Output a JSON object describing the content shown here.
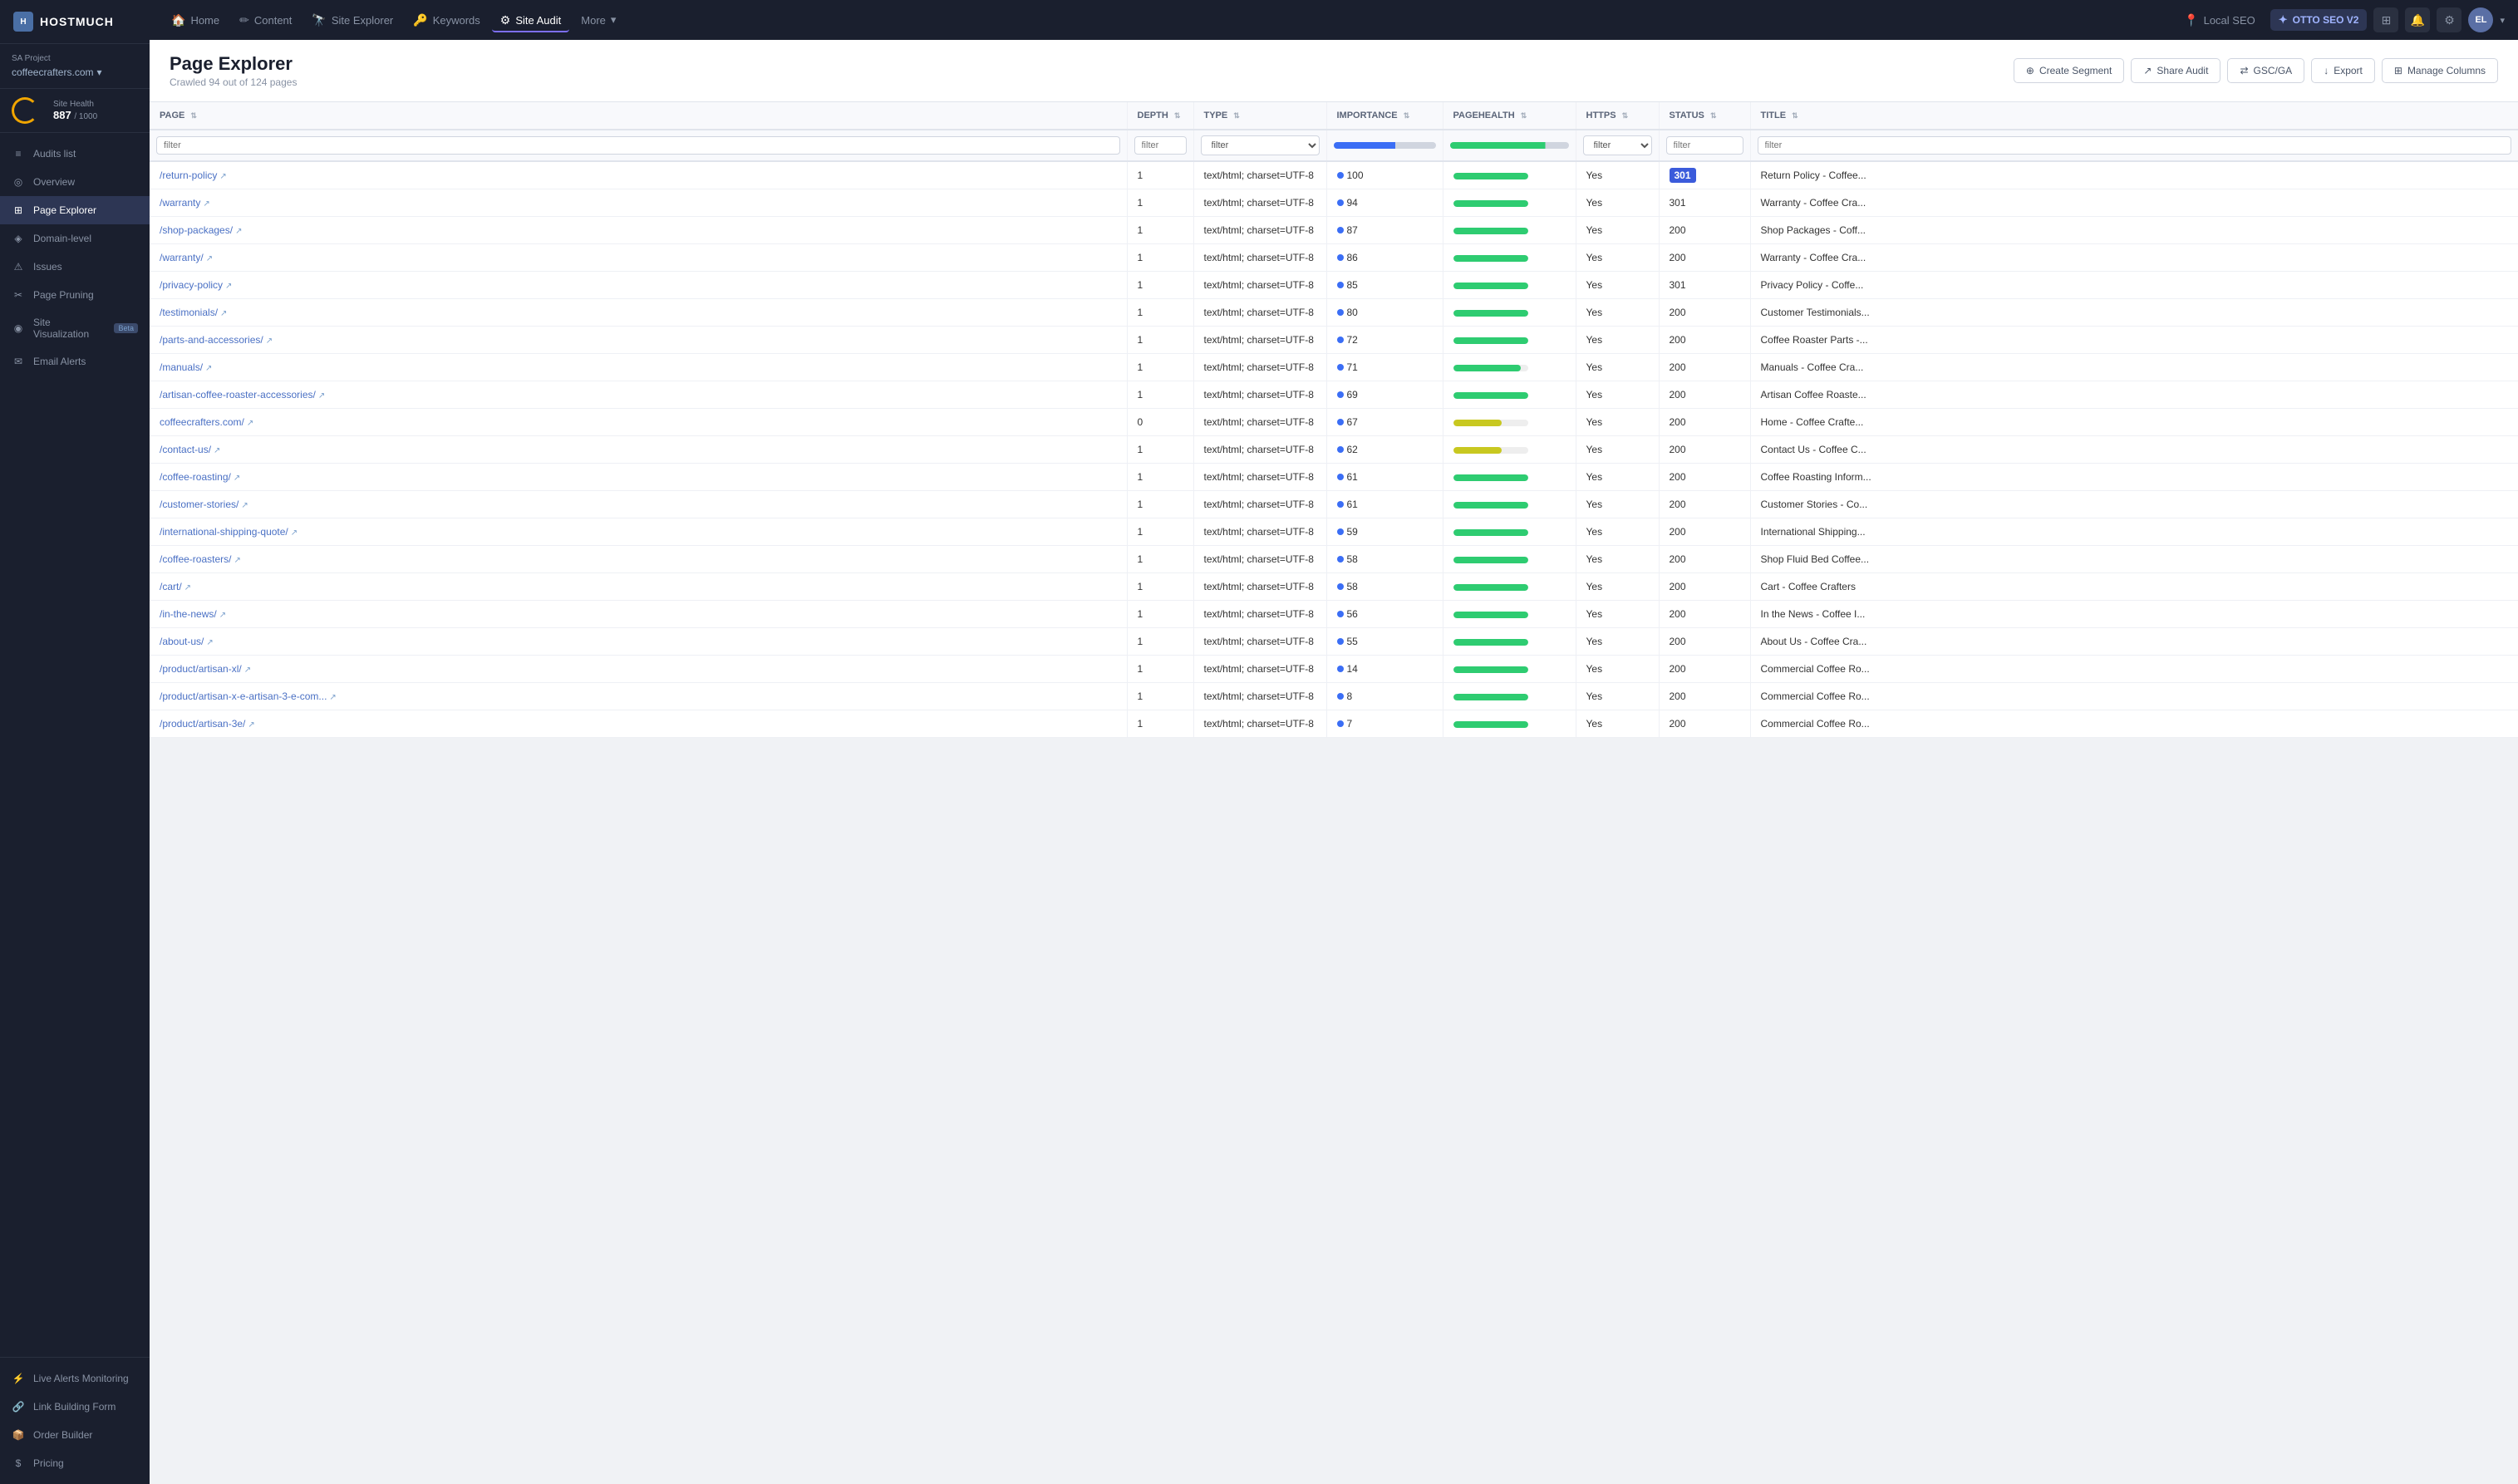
{
  "sidebar": {
    "logo_text": "HOSTMUCH",
    "project_label": "SA Project",
    "project_name": "coffeecrafters.com",
    "health_label": "Site Health",
    "health_value": "887",
    "health_max": "/ 1000",
    "nav_items": [
      {
        "id": "audits",
        "label": "Audits list",
        "icon": "≡"
      },
      {
        "id": "overview",
        "label": "Overview",
        "icon": "◎"
      },
      {
        "id": "explorer",
        "label": "Page Explorer",
        "icon": "⊞",
        "active": true
      },
      {
        "id": "domain",
        "label": "Domain-level",
        "icon": "◈"
      },
      {
        "id": "issues",
        "label": "Issues",
        "icon": "⚠"
      },
      {
        "id": "pruning",
        "label": "Page Pruning",
        "icon": "✂"
      },
      {
        "id": "visualization",
        "label": "Site Visualization",
        "icon": "◉",
        "beta": true
      },
      {
        "id": "alerts",
        "label": "Email Alerts",
        "icon": "✉"
      }
    ],
    "bottom_items": [
      {
        "id": "live-alerts",
        "label": "Live Alerts Monitoring",
        "icon": "⚡"
      },
      {
        "id": "link-building",
        "label": "Link Building Form",
        "icon": "🔗"
      },
      {
        "id": "order-builder",
        "label": "Order Builder",
        "icon": "📦"
      },
      {
        "id": "pricing",
        "label": "Pricing",
        "icon": "$"
      }
    ]
  },
  "topnav": {
    "items": [
      {
        "id": "home",
        "label": "Home",
        "icon": "🏠"
      },
      {
        "id": "content",
        "label": "Content",
        "icon": "✏"
      },
      {
        "id": "site-explorer",
        "label": "Site Explorer",
        "icon": "🔭"
      },
      {
        "id": "keywords",
        "label": "Keywords",
        "icon": "🔑"
      },
      {
        "id": "site-audit",
        "label": "Site Audit",
        "icon": "⚙",
        "active": true
      },
      {
        "id": "more",
        "label": "More",
        "icon": "▾"
      },
      {
        "id": "local-seo",
        "label": "Local SEO",
        "icon": "📍"
      }
    ],
    "otto_label": "OTTO SEO V2",
    "avatar_initials": "EL"
  },
  "page": {
    "title": "Page Explorer",
    "subtitle": "Crawled 94 out of 124 pages",
    "actions": [
      {
        "id": "create-segment",
        "label": "Create Segment",
        "icon": "⊕"
      },
      {
        "id": "share-audit",
        "label": "Share Audit",
        "icon": "↗"
      },
      {
        "id": "gsc-ga",
        "label": "GSC/GA",
        "icon": "⇄"
      },
      {
        "id": "export",
        "label": "Export",
        "icon": "↓"
      },
      {
        "id": "manage-columns",
        "label": "Manage Columns",
        "icon": "⊞"
      }
    ]
  },
  "table": {
    "columns": [
      {
        "id": "page",
        "label": "PAGE",
        "sortable": true
      },
      {
        "id": "depth",
        "label": "DEPTH",
        "sortable": true
      },
      {
        "id": "type",
        "label": "TYPE",
        "sortable": true
      },
      {
        "id": "importance",
        "label": "IMPORTANCE",
        "sortable": true
      },
      {
        "id": "pagehealth",
        "label": "PAGEHEALTH",
        "sortable": true
      },
      {
        "id": "https",
        "label": "HTTPS",
        "sortable": true
      },
      {
        "id": "status",
        "label": "STATUS",
        "sortable": true
      },
      {
        "id": "title",
        "label": "TITLE",
        "sortable": true
      }
    ],
    "rows": [
      {
        "page": "/return-policy",
        "depth": 1,
        "type": "text/html; charset=UTF-8",
        "importance": 100,
        "importance_color": "#3b6ef5",
        "health": 100,
        "health_color": "#2ecc71",
        "https": "Yes",
        "status": 301,
        "status_highlight": true,
        "title": "Return Policy - Coffee..."
      },
      {
        "page": "/warranty",
        "depth": 1,
        "type": "text/html; charset=UTF-8",
        "importance": 94,
        "importance_color": "#3b6ef5",
        "health": 100,
        "health_color": "#2ecc71",
        "https": "Yes",
        "status": 301,
        "status_highlight": false,
        "title": "Warranty - Coffee Cra..."
      },
      {
        "page": "/shop-packages/",
        "depth": 1,
        "type": "text/html; charset=UTF-8",
        "importance": 87,
        "importance_color": "#3b6ef5",
        "health": 100,
        "health_color": "#2ecc71",
        "https": "Yes",
        "status": 200,
        "status_highlight": false,
        "title": "Shop Packages - Coff..."
      },
      {
        "page": "/warranty/",
        "depth": 1,
        "type": "text/html; charset=UTF-8",
        "importance": 86,
        "importance_color": "#3b6ef5",
        "health": 100,
        "health_color": "#2ecc71",
        "https": "Yes",
        "status": 200,
        "status_highlight": false,
        "title": "Warranty - Coffee Cra..."
      },
      {
        "page": "/privacy-policy",
        "depth": 1,
        "type": "text/html; charset=UTF-8",
        "importance": 85,
        "importance_color": "#3b6ef5",
        "health": 100,
        "health_color": "#2ecc71",
        "https": "Yes",
        "status": 301,
        "status_highlight": false,
        "title": "Privacy Policy - Coffe..."
      },
      {
        "page": "/testimonials/",
        "depth": 1,
        "type": "text/html; charset=UTF-8",
        "importance": 80,
        "importance_color": "#3b6ef5",
        "health": 100,
        "health_color": "#2ecc71",
        "https": "Yes",
        "status": 200,
        "status_highlight": false,
        "title": "Customer Testimonials..."
      },
      {
        "page": "/parts-and-accessories/",
        "depth": 1,
        "type": "text/html; charset=UTF-8",
        "importance": 72,
        "importance_color": "#3b6ef5",
        "health": 100,
        "health_color": "#2ecc71",
        "https": "Yes",
        "status": 200,
        "status_highlight": false,
        "title": "Coffee Roaster Parts -..."
      },
      {
        "page": "/manuals/",
        "depth": 1,
        "type": "text/html; charset=UTF-8",
        "importance": 71,
        "importance_color": "#3b6ef5",
        "health": 90,
        "health_color": "#2ecc71",
        "https": "Yes",
        "status": 200,
        "status_highlight": false,
        "title": "Manuals - Coffee Cra..."
      },
      {
        "page": "/artisan-coffee-roaster-accessories/",
        "depth": 1,
        "type": "text/html; charset=UTF-8",
        "importance": 69,
        "importance_color": "#3b6ef5",
        "health": 100,
        "health_color": "#2ecc71",
        "https": "Yes",
        "status": 200,
        "status_highlight": false,
        "title": "Artisan Coffee Roaste..."
      },
      {
        "page": "coffeecrafters.com/",
        "depth": 0,
        "type": "text/html; charset=UTF-8",
        "importance": 67,
        "importance_color": "#3b6ef5",
        "health": 65,
        "health_color": "#c8c820",
        "https": "Yes",
        "status": 200,
        "status_highlight": false,
        "title": "Home - Coffee Crafte..."
      },
      {
        "page": "/contact-us/",
        "depth": 1,
        "type": "text/html; charset=UTF-8",
        "importance": 62,
        "importance_color": "#3b6ef5",
        "health": 65,
        "health_color": "#c8c820",
        "https": "Yes",
        "status": 200,
        "status_highlight": false,
        "title": "Contact Us - Coffee C..."
      },
      {
        "page": "/coffee-roasting/",
        "depth": 1,
        "type": "text/html; charset=UTF-8",
        "importance": 61,
        "importance_color": "#3b6ef5",
        "health": 100,
        "health_color": "#2ecc71",
        "https": "Yes",
        "status": 200,
        "status_highlight": false,
        "title": "Coffee Roasting Inform..."
      },
      {
        "page": "/customer-stories/",
        "depth": 1,
        "type": "text/html; charset=UTF-8",
        "importance": 61,
        "importance_color": "#3b6ef5",
        "health": 100,
        "health_color": "#2ecc71",
        "https": "Yes",
        "status": 200,
        "status_highlight": false,
        "title": "Customer Stories - Co..."
      },
      {
        "page": "/international-shipping-quote/",
        "depth": 1,
        "type": "text/html; charset=UTF-8",
        "importance": 59,
        "importance_color": "#3b6ef5",
        "health": 100,
        "health_color": "#2ecc71",
        "https": "Yes",
        "status": 200,
        "status_highlight": false,
        "title": "International Shipping..."
      },
      {
        "page": "/coffee-roasters/",
        "depth": 1,
        "type": "text/html; charset=UTF-8",
        "importance": 58,
        "importance_color": "#3b6ef5",
        "health": 100,
        "health_color": "#2ecc71",
        "https": "Yes",
        "status": 200,
        "status_highlight": false,
        "title": "Shop Fluid Bed Coffee..."
      },
      {
        "page": "/cart/",
        "depth": 1,
        "type": "text/html; charset=UTF-8",
        "importance": 58,
        "importance_color": "#3b6ef5",
        "health": 100,
        "health_color": "#2ecc71",
        "https": "Yes",
        "status": 200,
        "status_highlight": false,
        "title": "Cart - Coffee Crafters"
      },
      {
        "page": "/in-the-news/",
        "depth": 1,
        "type": "text/html; charset=UTF-8",
        "importance": 56,
        "importance_color": "#3b6ef5",
        "health": 100,
        "health_color": "#2ecc71",
        "https": "Yes",
        "status": 200,
        "status_highlight": false,
        "title": "In the News - Coffee I..."
      },
      {
        "page": "/about-us/",
        "depth": 1,
        "type": "text/html; charset=UTF-8",
        "importance": 55,
        "importance_color": "#3b6ef5",
        "health": 100,
        "health_color": "#2ecc71",
        "https": "Yes",
        "status": 200,
        "status_highlight": false,
        "title": "About Us - Coffee Cra..."
      },
      {
        "page": "/product/artisan-xl/",
        "depth": 1,
        "type": "text/html; charset=UTF-8",
        "importance": 14,
        "importance_color": "#3b6ef5",
        "health": 100,
        "health_color": "#2ecc71",
        "https": "Yes",
        "status": 200,
        "status_highlight": false,
        "title": "Commercial Coffee Ro..."
      },
      {
        "page": "/product/artisan-x-e-artisan-3-e-com...",
        "depth": 1,
        "type": "text/html; charset=UTF-8",
        "importance": 8,
        "importance_color": "#3b6ef5",
        "health": 100,
        "health_color": "#2ecc71",
        "https": "Yes",
        "status": 200,
        "status_highlight": false,
        "title": "Commercial Coffee Ro..."
      },
      {
        "page": "/product/artisan-3e/",
        "depth": 1,
        "type": "text/html; charset=UTF-8",
        "importance": 7,
        "importance_color": "#3b6ef5",
        "health": 100,
        "health_color": "#2ecc71",
        "https": "Yes",
        "status": 200,
        "status_highlight": false,
        "title": "Commercial Coffee Ro..."
      }
    ]
  }
}
